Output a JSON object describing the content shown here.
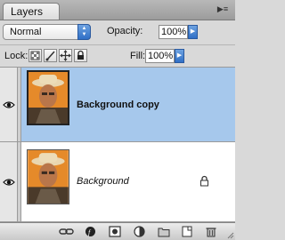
{
  "panel": {
    "tab_label": "Layers"
  },
  "options": {
    "blend_mode": "Normal",
    "opacity_label": "Opacity:",
    "opacity_value": "100%",
    "lock_label": "Lock:",
    "fill_label": "Fill:",
    "fill_value": "100%"
  },
  "layers": [
    {
      "name": "Background copy",
      "selected": true,
      "visible": true,
      "italic": false,
      "locked": false
    },
    {
      "name": "Background",
      "selected": false,
      "visible": true,
      "italic": true,
      "locked": true
    }
  ],
  "colors": {
    "selection": "#a6c8ec",
    "accent_blue": "#2f6fc6"
  },
  "bottom_icons": [
    "link-layers-icon",
    "layer-style-icon",
    "layer-mask-icon",
    "adjustment-layer-icon",
    "new-group-icon",
    "new-layer-icon",
    "trash-icon"
  ]
}
